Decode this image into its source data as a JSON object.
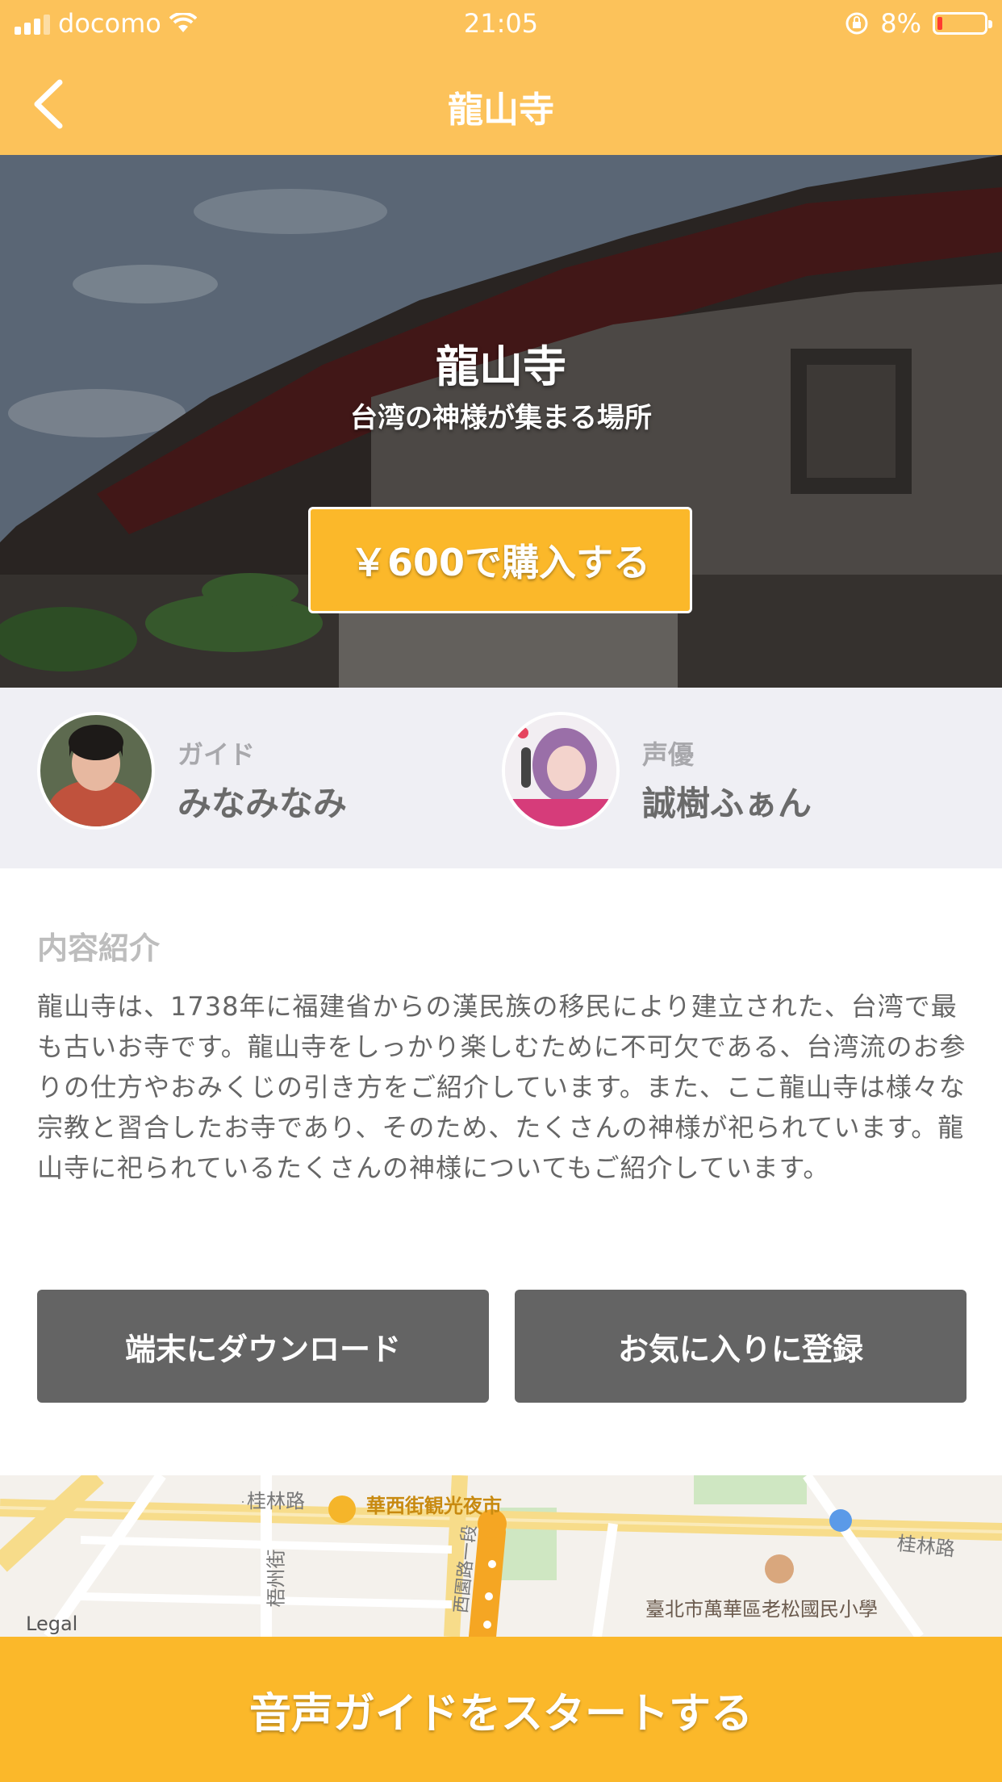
{
  "status_bar": {
    "carrier": "docomo",
    "time": "21:05",
    "battery": "8%"
  },
  "nav": {
    "title": "龍山寺"
  },
  "hero": {
    "title": "龍山寺",
    "subtitle": "台湾の神様が集まる場所",
    "buy_label": "￥600で購入する"
  },
  "people": [
    {
      "role": "ガイド",
      "name": "みなみなみ"
    },
    {
      "role": "声優",
      "name": "誠樹ふぁん"
    }
  ],
  "content": {
    "heading": "内容紹介",
    "description": "龍山寺は、1738年に福建省からの漢民族の移民により建立された、台湾で最も古いお寺です。龍山寺をしっかり楽しむために不可欠である、台湾流のお参りの仕方やおみくじの引き方をご紹介しています。また、ここ龍山寺は様々な宗教と習合したお寺であり、そのため、たくさんの神様が祀られています。龍山寺に祀られているたくさんの神様についてもご紹介しています。"
  },
  "actions": {
    "download_label": "端末にダウンロード",
    "favorite_label": "お気に入りに登録"
  },
  "map": {
    "labels": [
      "桂林路",
      "華西街観光夜市",
      "桂林路",
      "梧州街",
      "西園路一段",
      "臺北市萬華區老松國民小學"
    ],
    "legal": "Legal",
    "route_color": "#f5a623"
  },
  "footer": {
    "start_label": "音声ガイドをスタートする"
  },
  "colors": {
    "accent": "#fcc25a",
    "button": "#fbb82a",
    "dark_button": "#646464"
  }
}
